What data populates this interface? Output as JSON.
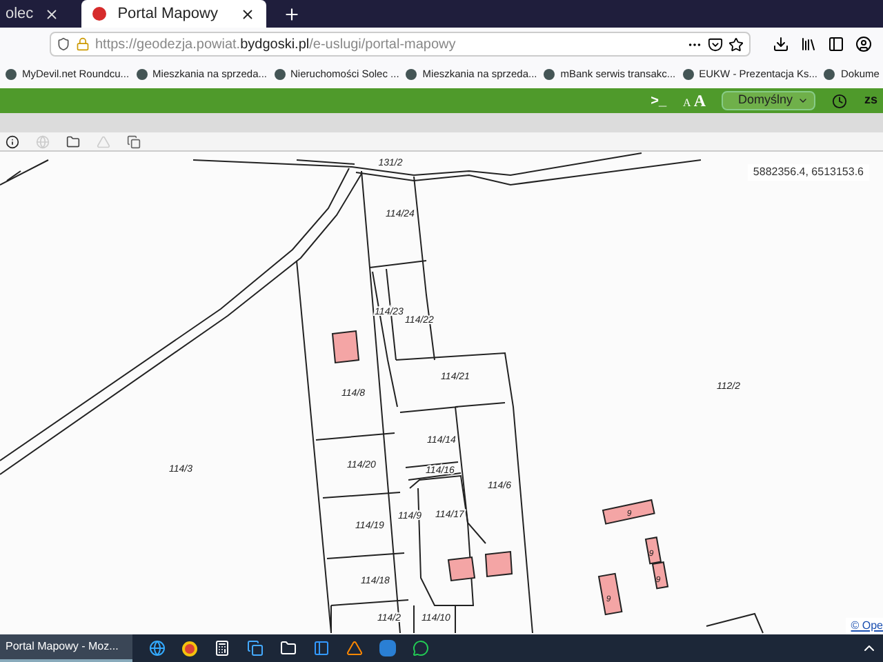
{
  "tabs": [
    {
      "label": "olec",
      "selected": false
    },
    {
      "label": "Portal Mapowy",
      "selected": true
    }
  ],
  "url": {
    "prefix": "https://geodezja.powiat.",
    "domain": "bydgoski.pl",
    "path": "/e-uslugi/portal-mapowy"
  },
  "bookmarks": [
    "MyDevil.net Roundcu...",
    "Mieszkania na sprzeda...",
    "Nieruchomości Solec ...",
    "Mieszkania na sprzeda...",
    "mBank serwis transakc...",
    "EUKW - Prezentacja Ks...",
    "Dokume"
  ],
  "app_bar": {
    "console": ">_",
    "font_small": "A",
    "font_large": "A",
    "profile": "Domyślny",
    "user": "zs"
  },
  "map": {
    "coordinates": "5882356.4, 6513153.6",
    "parcels": [
      "131/2",
      "114/24",
      "114/23",
      "114/22",
      "114/21",
      "114/8",
      "114/20",
      "114/14",
      "114/16",
      "114/6",
      "114/17",
      "114/9",
      "114/19",
      "114/18",
      "114/2",
      "114/10",
      "112/2",
      "114/3"
    ],
    "building_labels": [
      "9",
      "9",
      "9",
      "9"
    ],
    "attribution": "© Ope"
  },
  "taskbar": {
    "window": "Portal Mapowy - Moz..."
  }
}
